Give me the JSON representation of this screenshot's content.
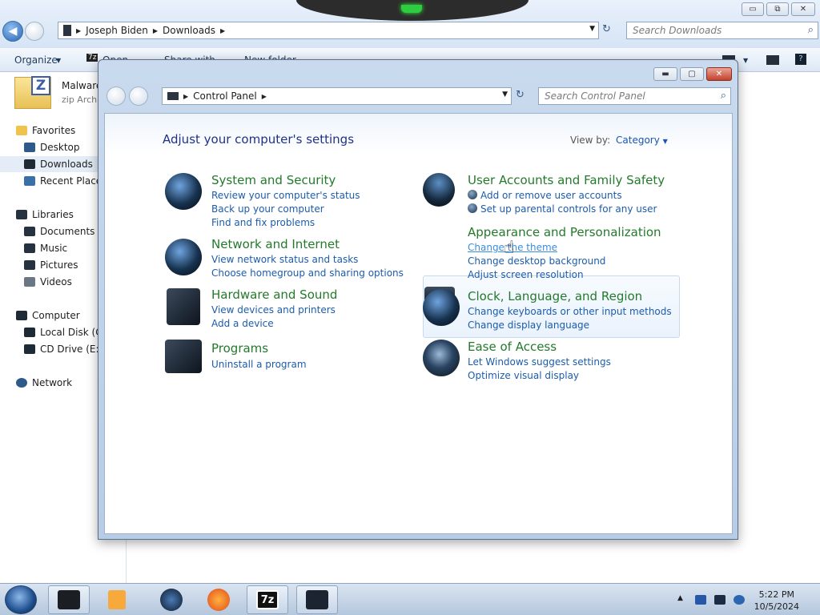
{
  "explorer": {
    "breadcrumb": [
      "Joseph Biden",
      "Downloads"
    ],
    "search_placeholder": "Search Downloads",
    "toolbar": {
      "organize": "Organize",
      "open": "Open",
      "share_with": "Share with",
      "new_folder": "New folder"
    },
    "file": {
      "name": "Malware",
      "type": "zip Archi",
      "icon_letter": "Z"
    },
    "sidebar": {
      "favorites": "Favorites",
      "favorites_items": [
        "Desktop",
        "Downloads",
        "Recent Places"
      ],
      "libraries": "Libraries",
      "libraries_items": [
        "Documents",
        "Music",
        "Pictures",
        "Videos"
      ],
      "computer": "Computer",
      "computer_items": [
        "Local Disk (C:",
        "CD Drive (E:) ("
      ],
      "network": "Network"
    },
    "window_buttons": {
      "minimize": "▭",
      "restore": "⧉",
      "close": "✕"
    }
  },
  "control_panel": {
    "breadcrumb": [
      "Control Panel"
    ],
    "search_placeholder": "Search Control Panel",
    "heading": "Adjust your computer's settings",
    "view_by_label": "View by:",
    "view_by_value": "Category",
    "categories_left": [
      {
        "title": "System and Security",
        "links": [
          "Review your computer's status",
          "Back up your computer",
          "Find and fix problems"
        ]
      },
      {
        "title": "Network and Internet",
        "links": [
          "View network status and tasks",
          "Choose homegroup and sharing options"
        ]
      },
      {
        "title": "Hardware and Sound",
        "links": [
          "View devices and printers",
          "Add a device"
        ]
      },
      {
        "title": "Programs",
        "links": [
          "Uninstall a program"
        ]
      }
    ],
    "categories_right": [
      {
        "title": "User Accounts and Family Safety",
        "links": [
          "Add or remove user accounts",
          "Set up parental controls for any user"
        ]
      },
      {
        "title": "Appearance and Personalization",
        "links": [
          "Change the theme",
          "Change desktop background",
          "Adjust screen resolution"
        ]
      },
      {
        "title": "Clock, Language, and Region",
        "links": [
          "Change keyboards or other input methods",
          "Change display language"
        ]
      },
      {
        "title": "Ease of Access",
        "links": [
          "Let Windows suggest settings",
          "Optimize visual display"
        ]
      }
    ],
    "window_buttons": {
      "minimize": "▬",
      "maximize": "▢",
      "close": "✕"
    }
  },
  "taskbar": {
    "time": "5:22 PM",
    "date": "10/5/2024",
    "sevenzip_label": "7z"
  },
  "colors": {
    "link": "#1c5cab",
    "category_title": "#237a2b",
    "heading": "#1e3287"
  }
}
